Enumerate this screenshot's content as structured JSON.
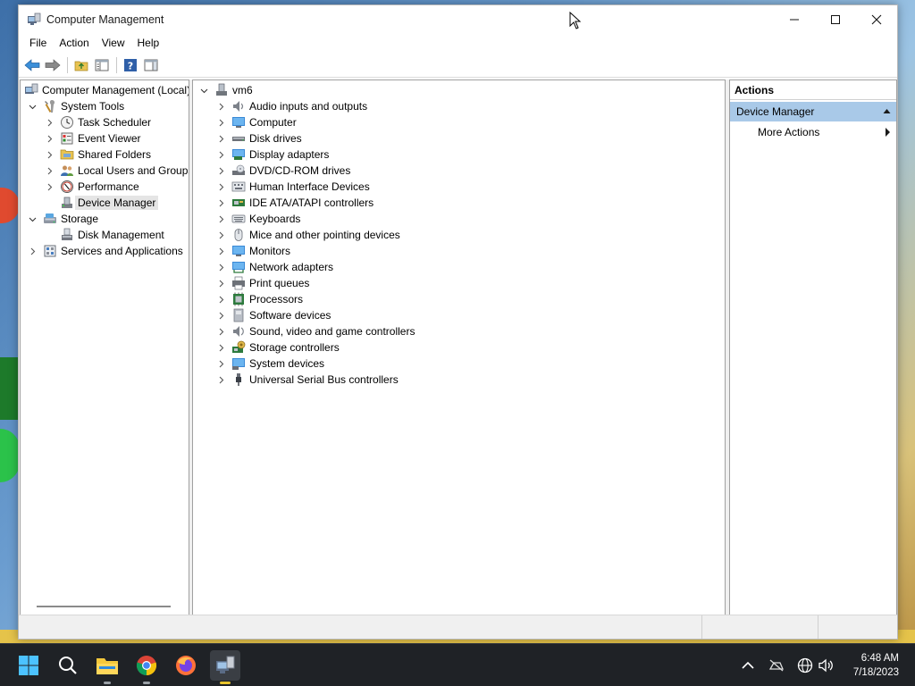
{
  "window": {
    "title": "Computer Management",
    "minimize_icon": "minimize-icon",
    "maximize_icon": "maximize-icon",
    "close_icon": "close-icon"
  },
  "menu": {
    "items": [
      "File",
      "Action",
      "View",
      "Help"
    ]
  },
  "toolbar": {
    "icons": [
      "back-arrow-icon",
      "forward-arrow-icon",
      "up-folder-icon",
      "show-hide-tree-icon",
      "help-icon",
      "show-hide-action-pane-icon"
    ]
  },
  "left_tree": {
    "root": "Computer Management (Local)",
    "items": [
      {
        "label": "System Tools",
        "icon": "tools-icon",
        "expander": "expanded"
      },
      {
        "label": "Task Scheduler",
        "icon": "clock-icon",
        "expander": "collapsed"
      },
      {
        "label": "Event Viewer",
        "icon": "event-viewer-icon",
        "expander": "collapsed"
      },
      {
        "label": "Shared Folders",
        "icon": "shared-folder-icon",
        "expander": "collapsed"
      },
      {
        "label": "Local Users and Groups",
        "icon": "users-icon",
        "expander": "collapsed"
      },
      {
        "label": "Performance",
        "icon": "performance-icon",
        "expander": "collapsed"
      },
      {
        "label": "Device Manager",
        "icon": "device-manager-icon",
        "expander": "none",
        "selected": true
      },
      {
        "label": "Storage",
        "icon": "storage-icon",
        "expander": "expanded"
      },
      {
        "label": "Disk Management",
        "icon": "disk-management-icon",
        "expander": "none"
      },
      {
        "label": "Services and Applications",
        "icon": "services-icon",
        "expander": "collapsed"
      }
    ]
  },
  "device_tree": {
    "root": "vm6",
    "categories": [
      {
        "label": "Audio inputs and outputs",
        "icon": "speaker-icon"
      },
      {
        "label": "Computer",
        "icon": "computer-icon"
      },
      {
        "label": "Disk drives",
        "icon": "disk-drive-icon"
      },
      {
        "label": "Display adapters",
        "icon": "display-adapter-icon"
      },
      {
        "label": "DVD/CD-ROM drives",
        "icon": "dvd-drive-icon"
      },
      {
        "label": "Human Interface Devices",
        "icon": "hid-icon"
      },
      {
        "label": "IDE ATA/ATAPI controllers",
        "icon": "ide-controller-icon"
      },
      {
        "label": "Keyboards",
        "icon": "keyboard-icon"
      },
      {
        "label": "Mice and other pointing devices",
        "icon": "mouse-icon"
      },
      {
        "label": "Monitors",
        "icon": "monitor-icon"
      },
      {
        "label": "Network adapters",
        "icon": "network-adapter-icon"
      },
      {
        "label": "Print queues",
        "icon": "printer-icon"
      },
      {
        "label": "Processors",
        "icon": "processor-icon"
      },
      {
        "label": "Software devices",
        "icon": "software-device-icon"
      },
      {
        "label": "Sound, video and game controllers",
        "icon": "sound-controller-icon"
      },
      {
        "label": "Storage controllers",
        "icon": "storage-controller-icon"
      },
      {
        "label": "System devices",
        "icon": "system-devices-icon"
      },
      {
        "label": "Universal Serial Bus controllers",
        "icon": "usb-icon"
      }
    ]
  },
  "actions": {
    "header": "Actions",
    "section": "Device Manager",
    "items": [
      "More Actions"
    ]
  },
  "taskbar": {
    "apps": [
      "start-icon",
      "search-icon",
      "file-explorer-icon",
      "chrome-icon",
      "firefox-icon",
      "computer-management-icon"
    ],
    "tray": [
      "chevron-up-icon",
      "network-disconnected-icon",
      "globe-icon",
      "volume-icon"
    ],
    "time": "6:48 AM",
    "date": "7/18/2023"
  },
  "colors": {
    "accent": "#0078d4",
    "selection": "#e5e5e5",
    "action_section": "#a9c9e8",
    "taskbar": "#1f2226"
  }
}
